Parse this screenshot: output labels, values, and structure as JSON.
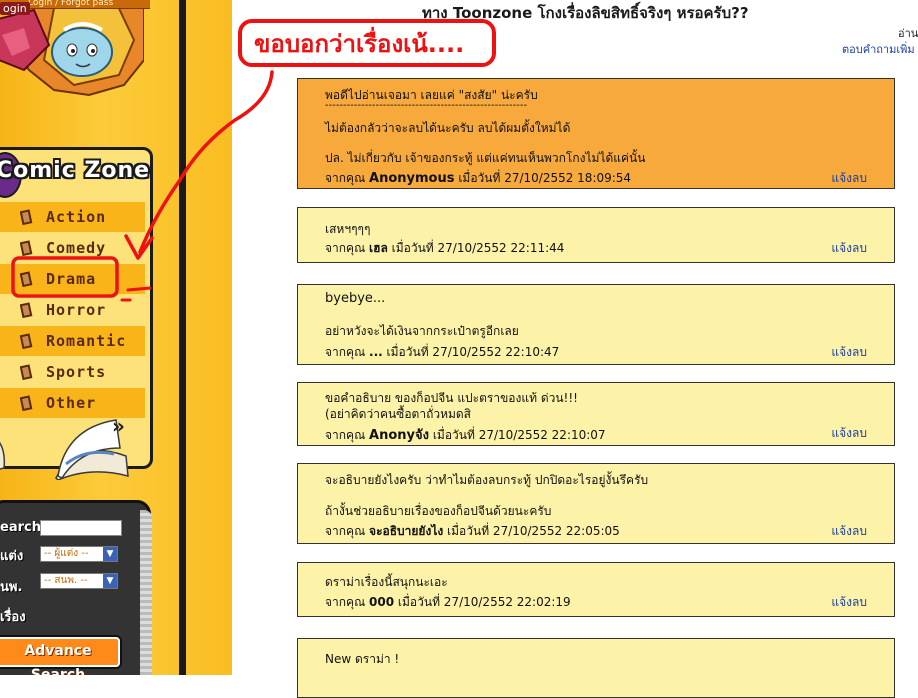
{
  "site": {
    "login_label": "ogin",
    "tagline": "Login / Forgot pass",
    "comic_zone_title": "Comic Zone",
    "categories": [
      {
        "label": "Action"
      },
      {
        "label": "Comedy"
      },
      {
        "label": "Drama"
      },
      {
        "label": "Horror"
      },
      {
        "label": "Romantic"
      },
      {
        "label": "Sports"
      },
      {
        "label": "Other"
      }
    ],
    "more_symbol": "»",
    "search": {
      "label_search": "earch",
      "label_author": "แต่ง",
      "label_publisher": "นพ.",
      "label_story": "เรื่อง",
      "author_select": "-- ผู้แต่ง --",
      "publisher_select": "-- สนพ. --",
      "advance_button": "Advance Search"
    }
  },
  "thread": {
    "title": "ทาง Toonzone โกงเรื่องลิขสิทธิ์จริงๆ หรอครับ??",
    "top_right_line1": "อ่าน",
    "top_right_line2": "ตอบคำถามเพิ่ม จ"
  },
  "annotation": {
    "bubble_text": "ขอบอกว่าเรื่องเน้...."
  },
  "comments": [
    {
      "lines": [
        "พอดีไปอ่านเจอมา เลยแค่ \"สงสัย\" น่ะครับ",
        "--------------------------------------------------------",
        "ไม่ต้องกลัวว่าจะลบได้นะครับ ลบได้ผมตั้งใหม่ได้",
        "",
        "ปล. ไม่เกี่ยวกับ เจ้าของกระทู้ แต่แค่ทนเห็นพวกโกงไม่ได้แค่นั้น"
      ],
      "prefix": "จากคุณ",
      "author": "Anonymous",
      "date": "เมื่อวันที่ 27/10/2552 18:09:54",
      "report": "แจ้งลบ"
    },
    {
      "lines": [
        "เสหฯๆๆๆ"
      ],
      "prefix": "จากคุณ",
      "author": "เฮล",
      "date": "เมื่อวันที่ 27/10/2552 22:11:44",
      "report": "แจ้งลบ"
    },
    {
      "lines": [
        "byebye...",
        "",
        "อย่าหวังจะได้เงินจากกระเป๋าตรูอีกเลย"
      ],
      "prefix": "จากคุณ",
      "author": "...",
      "date": "เมื่อวันที่ 27/10/2552 22:10:47",
      "report": "แจ้งลบ"
    },
    {
      "lines": [
        "ขอคำอธิบาย ของก็อปจีน แปะตราของแท้ ด่วน!!!",
        "(อย่าคิดว่าคนซื้อตาถั่วหมดสิ"
      ],
      "prefix": "จากคุณ",
      "author": "Anonyจัง",
      "date": "เมื่อวันที่ 27/10/2552 22:10:07",
      "report": "แจ้งลบ"
    },
    {
      "lines": [
        "จะอธิบายยังไงครับ ว่าทำไมต้องลบกระทู้ ปกปิดอะไรอยู่งั้นรึครับ",
        "",
        "ถ้างั้นช่วยอธิบายเรื่องของก็อปจีนด้วยนะครับ"
      ],
      "prefix": "จากคุณ",
      "author": "จะอธิบายยังไง",
      "date": "เมื่อวันที่ 27/10/2552 22:05:05",
      "report": "แจ้งลบ"
    },
    {
      "lines": [
        "ดราม่าเรื่องนี้สนุกนะเอะ"
      ],
      "prefix": "จากคุณ",
      "author": "000",
      "date": "เมื่อวันที่ 27/10/2552 22:02:19",
      "report": "แจ้งลบ"
    },
    {
      "lines": [
        "New ดราม่า !"
      ],
      "prefix": "",
      "author": "",
      "date": "",
      "report": ""
    }
  ],
  "colors": {
    "sidebar_orange": "#f7b417",
    "comment_bg": "#fdf3a8",
    "comment_highlight": "#f7a93c",
    "link_blue": "#1a3fa0",
    "annotation_red": "#ee1111"
  }
}
